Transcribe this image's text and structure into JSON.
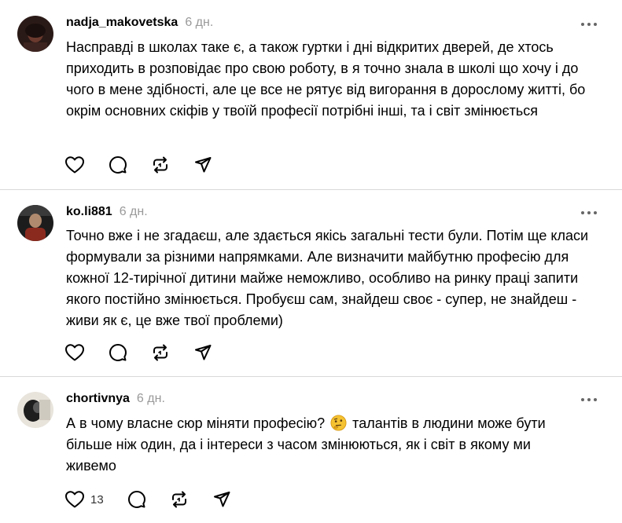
{
  "posts": [
    {
      "username": "nadja_makovetska",
      "time": "6 дн.",
      "text": "Насправді в школах таке є, а також гуртки і дні відкритих дверей, де хтось приходить в розповідає про свою роботу, в я точно знала в школі що хочу і до чого в мене здібності, але це все не рятує від вигорання в дорослому житті, бо окрім основних скіфів у твоїй професії потрібні інші, та і світ змінюється",
      "like_count": ""
    },
    {
      "username": "ko.li881",
      "time": "6 дн.",
      "text": "Точно вже і не згадаєш, але здається якісь загальні тести були. Потім ще класи формували за різними напрямками. Але визначити майбутню професію для кожної 12-тирічної дитини майже неможливо, особливо на ринку праці запити якого постійно змінюється. Пробуєш сам, знайдеш своє - супер, не знайдеш - живи як є, це вже твої проблеми)",
      "like_count": ""
    },
    {
      "username": "chortivnya",
      "time": "6 дн.",
      "text_before_emoji": "А в чому власне сюр міняти професію?",
      "emoji": "thinking-face",
      "text_after_emoji": "талантів в людини може бути більше ніж один, да і інтереси з часом змінюються, як і світ в якому ми живемо",
      "like_count": "13"
    }
  ],
  "icons": {
    "like": "heart-icon",
    "reply": "comment-bubble-icon",
    "repost": "repost-icon",
    "share": "send-icon",
    "more": "more-icon"
  },
  "colors": {
    "text": "#000000",
    "muted": "#999999",
    "divider": "#d9d9d9",
    "icon": "#000000"
  }
}
